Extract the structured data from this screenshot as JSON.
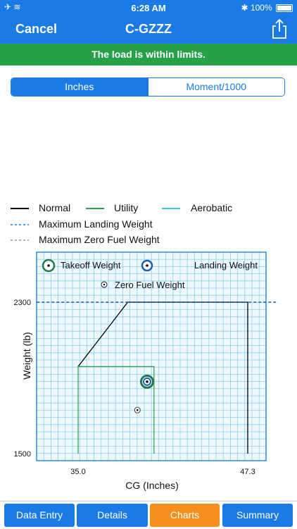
{
  "status": {
    "time": "6:28 AM",
    "battery": "100%"
  },
  "nav": {
    "cancel": "Cancel",
    "title": "C-GZZZ"
  },
  "banner": "The load is within limits.",
  "segments": [
    "Inches",
    "Moment/1000"
  ],
  "legend": {
    "normal": "Normal",
    "utility": "Utility",
    "aerobatic": "Aerobatic",
    "mlw": "Maximum Landing Weight",
    "mzfw": "Maximum Zero Fuel Weight"
  },
  "markers": {
    "takeoff": "Takeoff Weight",
    "landing": "Landing Weight",
    "zerofuel": "Zero Fuel Weight"
  },
  "tabs": [
    "Data Entry",
    "Details",
    "Charts",
    "Summary"
  ],
  "colors": {
    "accent": "#1a7be6",
    "ok": "#27a148",
    "active_tab": "#f5901e",
    "normal": "#000000",
    "utility": "#27a148",
    "aerobatic": "#39c1e8",
    "grid": "#9fd7f2"
  },
  "chart_data": {
    "type": "line",
    "xlabel": "CG (Inches)",
    "ylabel": "Weight (lb)",
    "x_ticks": [
      "35.0",
      "47.3"
    ],
    "y_ticks": [
      "2300",
      "1500"
    ],
    "grid": true,
    "series": [
      {
        "name": "Normal",
        "x": [
          35.0,
          38.6,
          47.3,
          47.3
        ],
        "y": [
          1960,
          2300,
          2300,
          1500
        ]
      },
      {
        "name": "Utility",
        "x": [
          35.0,
          35.0,
          40.5,
          40.5
        ],
        "y": [
          1500,
          1960,
          1960,
          1500
        ]
      },
      {
        "name": "Maximum Landing Weight",
        "x": [
          32.0,
          49.5
        ],
        "y": [
          2300,
          2300
        ]
      }
    ],
    "points": [
      {
        "name": "Takeoff Weight",
        "x": 40.0,
        "y": 1880
      },
      {
        "name": "Landing Weight",
        "x": 40.0,
        "y": 1880
      },
      {
        "name": "Zero Fuel Weight",
        "x": 39.3,
        "y": 1730
      }
    ]
  }
}
